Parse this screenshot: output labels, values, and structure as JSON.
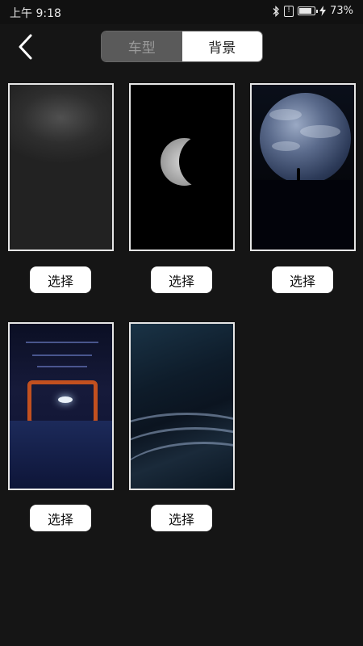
{
  "status_bar": {
    "time": "上午 9:18",
    "sim_label": "!",
    "battery_percent": "73%",
    "battery_level": 0.73,
    "icons": [
      "bluetooth-icon",
      "sim-icon",
      "battery-icon",
      "charging-icon"
    ]
  },
  "header": {
    "back_icon": "chevron-left-icon",
    "tabs": [
      {
        "label": "车型",
        "active": false
      },
      {
        "label": "背景",
        "active": true
      }
    ]
  },
  "backgrounds": [
    {
      "name": "gray-gradient",
      "button": "选择"
    },
    {
      "name": "moon",
      "button": "选择"
    },
    {
      "name": "earth",
      "button": "选择"
    },
    {
      "name": "tunnel",
      "button": "选择"
    },
    {
      "name": "planet-rings",
      "button": "选择"
    }
  ],
  "colors": {
    "page_bg": "#151515",
    "tab_active_bg": "#ffffff",
    "tab_inactive_bg": "#5a5a5a",
    "card_border": "#e6e6e6"
  }
}
